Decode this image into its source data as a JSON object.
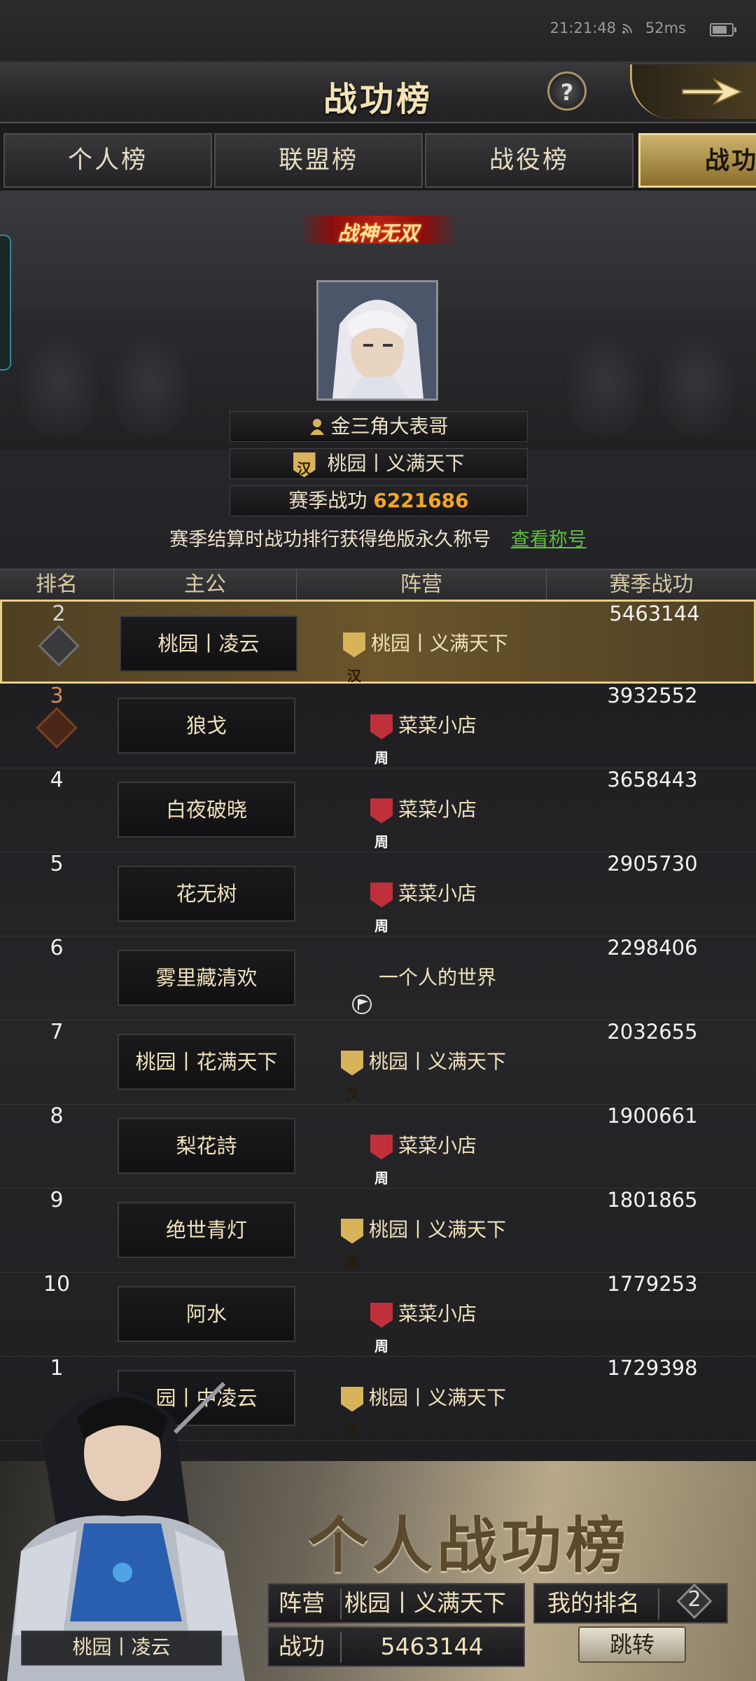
{
  "status_bar": {
    "time": "21:21:48",
    "ping": "52ms"
  },
  "header": {
    "title": "战功榜",
    "help": "?"
  },
  "tabs": [
    {
      "label": "个人榜"
    },
    {
      "label": "联盟榜"
    },
    {
      "label": "战役榜"
    },
    {
      "label": "战功"
    }
  ],
  "top_player": {
    "badge": "战神无双",
    "name": "金三角大表哥",
    "faction_char": "汉",
    "alliance": "桃园丨义满天下",
    "season_label": "赛季战功",
    "season_value": "6221686"
  },
  "hint": {
    "text": "赛季结算时战功排行获得绝版永久称号",
    "link": "查看称号"
  },
  "table": {
    "headers": [
      "排名",
      "主公",
      "阵营",
      "赛季战功"
    ],
    "rows": [
      {
        "rank": "2",
        "name": "桃园丨凌云",
        "faction_char": "汉",
        "faction": "桃园丨义满天下",
        "power": "5463144"
      },
      {
        "rank": "3",
        "name": "狼戈",
        "faction_char": "周",
        "faction": "菜菜小店",
        "power": "3932552"
      },
      {
        "rank": "4",
        "name": "白夜破晓",
        "faction_char": "周",
        "faction": "菜菜小店",
        "power": "3658443"
      },
      {
        "rank": "5",
        "name": "花无树",
        "faction_char": "周",
        "faction": "菜菜小店",
        "power": "2905730"
      },
      {
        "rank": "6",
        "name": "雾里藏清欢",
        "faction_char": "",
        "faction": "一个人的世界",
        "power": "2298406"
      },
      {
        "rank": "7",
        "name": "桃园丨花满天下",
        "faction_char": "汉",
        "faction": "桃园丨义满天下",
        "power": "2032655"
      },
      {
        "rank": "8",
        "name": "梨花詩",
        "faction_char": "周",
        "faction": "菜菜小店",
        "power": "1900661"
      },
      {
        "rank": "9",
        "name": "绝世青灯",
        "faction_char": "汉",
        "faction": "桃园丨义满天下",
        "power": "1801865"
      },
      {
        "rank": "10",
        "name": "阿水",
        "faction_char": "周",
        "faction": "菜菜小店",
        "power": "1779253"
      },
      {
        "rank": "1",
        "name": "园丨中凌云",
        "faction_char": "汉",
        "faction": "桃园丨义满天下",
        "power": "1729398"
      }
    ]
  },
  "footer": {
    "title": "个人战功榜",
    "faction_label": "阵营",
    "faction_value": "桃园丨义满天下",
    "my_rank_label": "我的排名",
    "my_rank_value": "2",
    "power_label": "战功",
    "power_value": "5463144",
    "jump_label": "跳转",
    "character_name": "桃园丨凌云"
  },
  "colors": {
    "gold_accent": "#f5a623",
    "link_green": "#5fbf3e",
    "han_shield": "#d9b35a",
    "zhou_shield": "#c0303b"
  }
}
